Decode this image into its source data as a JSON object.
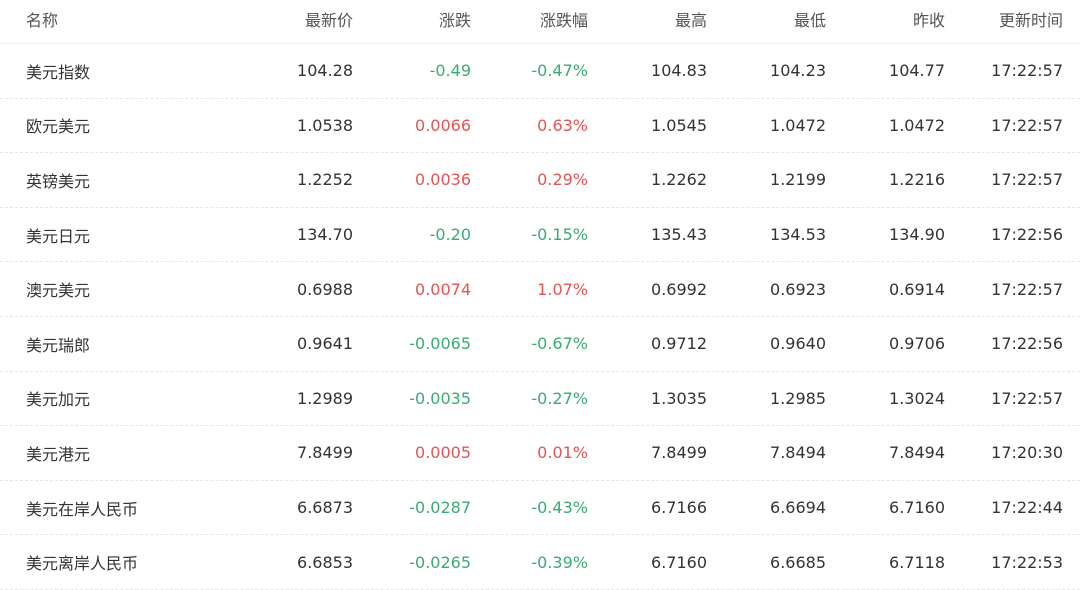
{
  "columns": {
    "name": "名称",
    "price": "最新价",
    "change": "涨跌",
    "pct": "涨跌幅",
    "high": "最高",
    "low": "最低",
    "prev": "昨收",
    "time": "更新时间"
  },
  "colors": {
    "up": "#e65454",
    "down": "#3bab75",
    "text": "#333333"
  },
  "rows": [
    {
      "name": "美元指数",
      "price": "104.28",
      "change": "-0.49",
      "pct": "-0.47%",
      "high": "104.83",
      "low": "104.23",
      "prev": "104.77",
      "time": "17:22:57",
      "direction": "down"
    },
    {
      "name": "欧元美元",
      "price": "1.0538",
      "change": "0.0066",
      "pct": "0.63%",
      "high": "1.0545",
      "low": "1.0472",
      "prev": "1.0472",
      "time": "17:22:57",
      "direction": "up"
    },
    {
      "name": "英镑美元",
      "price": "1.2252",
      "change": "0.0036",
      "pct": "0.29%",
      "high": "1.2262",
      "low": "1.2199",
      "prev": "1.2216",
      "time": "17:22:57",
      "direction": "up"
    },
    {
      "name": "美元日元",
      "price": "134.70",
      "change": "-0.20",
      "pct": "-0.15%",
      "high": "135.43",
      "low": "134.53",
      "prev": "134.90",
      "time": "17:22:56",
      "direction": "down"
    },
    {
      "name": "澳元美元",
      "price": "0.6988",
      "change": "0.0074",
      "pct": "1.07%",
      "high": "0.6992",
      "low": "0.6923",
      "prev": "0.6914",
      "time": "17:22:57",
      "direction": "up"
    },
    {
      "name": "美元瑞郎",
      "price": "0.9641",
      "change": "-0.0065",
      "pct": "-0.67%",
      "high": "0.9712",
      "low": "0.9640",
      "prev": "0.9706",
      "time": "17:22:56",
      "direction": "down"
    },
    {
      "name": "美元加元",
      "price": "1.2989",
      "change": "-0.0035",
      "pct": "-0.27%",
      "high": "1.3035",
      "low": "1.2985",
      "prev": "1.3024",
      "time": "17:22:57",
      "direction": "down"
    },
    {
      "name": "美元港元",
      "price": "7.8499",
      "change": "0.0005",
      "pct": "0.01%",
      "high": "7.8499",
      "low": "7.8494",
      "prev": "7.8494",
      "time": "17:20:30",
      "direction": "up"
    },
    {
      "name": "美元在岸人民币",
      "price": "6.6873",
      "change": "-0.0287",
      "pct": "-0.43%",
      "high": "6.7166",
      "low": "6.6694",
      "prev": "6.7160",
      "time": "17:22:44",
      "direction": "down"
    },
    {
      "name": "美元离岸人民币",
      "price": "6.6853",
      "change": "-0.0265",
      "pct": "-0.39%",
      "high": "6.7160",
      "low": "6.6685",
      "prev": "6.7118",
      "time": "17:22:53",
      "direction": "down"
    }
  ]
}
